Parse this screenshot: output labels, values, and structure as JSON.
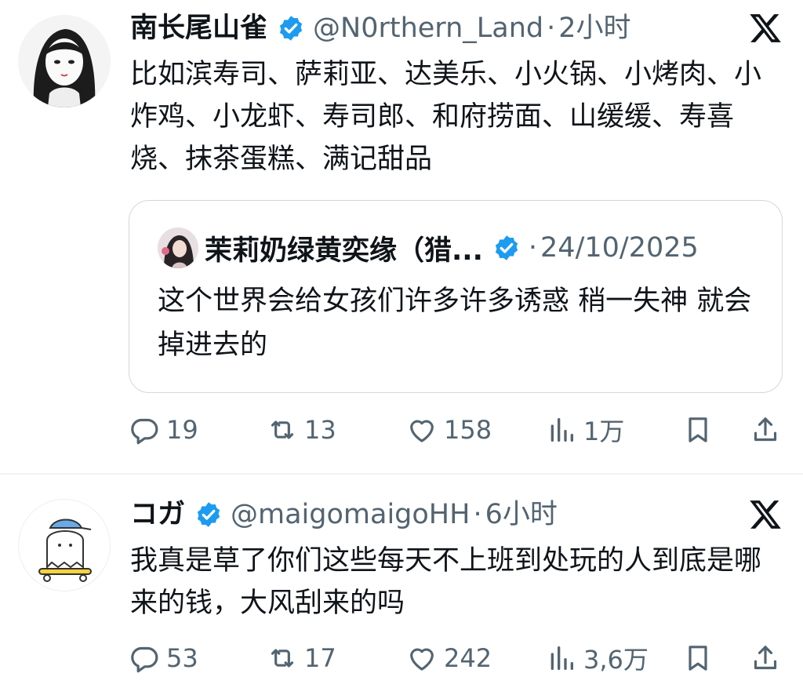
{
  "colors": {
    "verified": "#1d9bf0",
    "text": "#0f1419",
    "muted": "#536471",
    "border": "#cfd9de"
  },
  "tweets": [
    {
      "name": "南长尾山雀",
      "handle": "@N0rthern_Land",
      "dot": "·",
      "time": "2小时",
      "text": "比如滨寿司、萨莉亚、达美乐、小火锅、小烤肉、小炸鸡、小龙虾、寿司郎、和府捞面、山缓缓、寿喜烧、抹茶蛋糕、满记甜品",
      "quote": {
        "name": "茉莉奶绿黄奕缘（猎...",
        "dot": "·",
        "date": "24/10/2025",
        "text": "这个世界会给女孩们许多许多诱惑 稍一失神 就会掉进去的"
      },
      "stats": {
        "replies": "19",
        "reposts": "13",
        "likes": "158",
        "views": "1万"
      }
    },
    {
      "name": "コガ",
      "handle": "@maigomaigoHH",
      "dot": "·",
      "time": "6小时",
      "text": "我真是草了你们这些每天不上班到处玩的人到底是哪来的钱，大风刮来的吗",
      "stats": {
        "replies": "53",
        "reposts": "17",
        "likes": "242",
        "views": "3,6万"
      }
    }
  ]
}
